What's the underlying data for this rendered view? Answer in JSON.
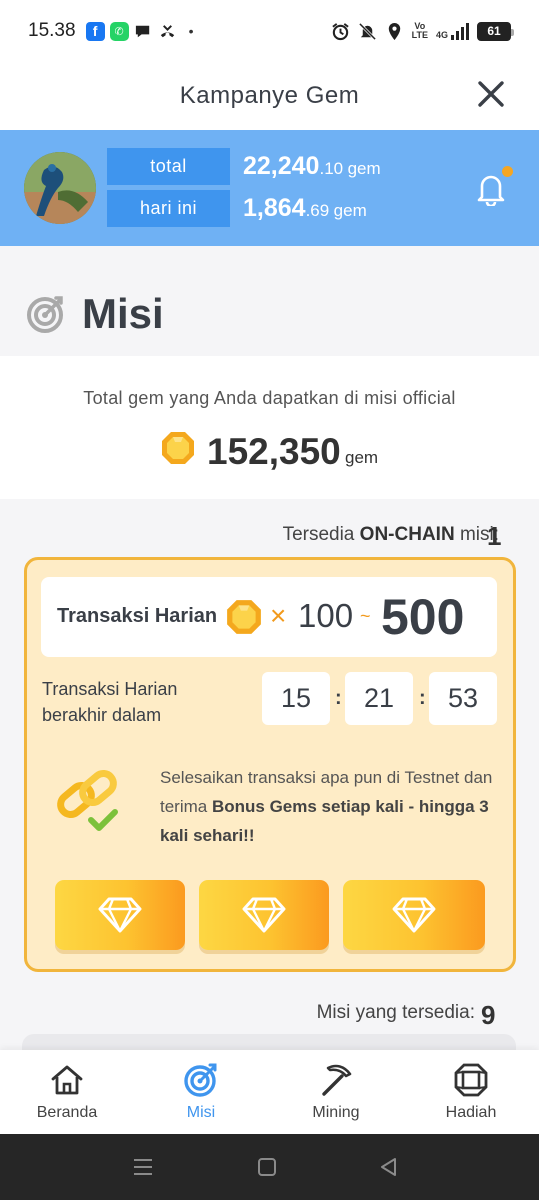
{
  "status_bar": {
    "time": "15.38",
    "network": "4G",
    "volte_top": "Vo",
    "volte_bottom": "LTE",
    "battery": "61"
  },
  "header": {
    "title": "Kampanye Gem"
  },
  "user": {
    "total_label": "total",
    "total_int": "22,240",
    "total_dec": ".10",
    "today_label": "hari ini",
    "today_int": "1,864",
    "today_dec": ".69",
    "unit": "gem"
  },
  "misi": {
    "title": "Misi",
    "total_caption": "Total gem yang Anda dapatkan di misi official",
    "total_value": "152,350",
    "total_unit": "gem"
  },
  "onchain": {
    "caption_prefix": "Tersedia ",
    "caption_bold": "ON-CHAIN",
    "caption_suffix": " misi:",
    "count": "1"
  },
  "daily_mission": {
    "title": "Transaksi Harian",
    "multiplier": "×",
    "reward_min": "100",
    "tilde": "~",
    "reward_max": "500",
    "timer_label": "Transaksi Harian berakhir dalam",
    "hours": "15",
    "minutes": "21",
    "seconds": "53",
    "separator": ":",
    "desc_plain": "Selesaikan transaksi apa pun di Testnet dan terima ",
    "desc_bold": "Bonus Gems setiap kali - hingga 3 kali sehari!!"
  },
  "available": {
    "caption": "Misi yang tersedia:",
    "count": "9"
  },
  "bottom_nav": [
    {
      "label": "Beranda",
      "icon": "home-icon"
    },
    {
      "label": "Misi",
      "icon": "target-icon",
      "active": true
    },
    {
      "label": "Mining",
      "icon": "pickaxe-icon"
    },
    {
      "label": "Hadiah",
      "icon": "gift-box-icon"
    }
  ],
  "colors": {
    "accent_blue": "#3f95ee",
    "header_blue": "#6fb1f4",
    "gem_orange": "#f29a1d",
    "card_bg": "#feecc6",
    "card_border": "#f1b53c"
  }
}
